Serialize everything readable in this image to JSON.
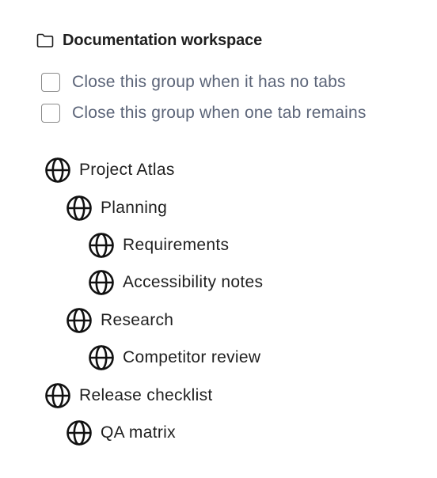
{
  "group": {
    "title": "Documentation workspace",
    "icon": "folder-icon"
  },
  "options": [
    {
      "label": "Close this group when it has no tabs",
      "checked": false
    },
    {
      "label": "Close this group when one tab remains",
      "checked": false
    }
  ],
  "tree": [
    {
      "label": "Project Atlas",
      "level": 0,
      "icon": "globe-icon"
    },
    {
      "label": "Planning",
      "level": 1,
      "icon": "globe-icon"
    },
    {
      "label": "Requirements",
      "level": 2,
      "icon": "globe-icon"
    },
    {
      "label": "Accessibility notes",
      "level": 2,
      "icon": "globe-icon"
    },
    {
      "label": "Research",
      "level": 1,
      "icon": "globe-icon"
    },
    {
      "label": "Competitor review",
      "level": 2,
      "icon": "globe-icon"
    },
    {
      "label": "Release checklist",
      "level": 0,
      "icon": "globe-icon"
    },
    {
      "label": "QA matrix",
      "level": 1,
      "icon": "globe-icon"
    }
  ],
  "colors": {
    "text": "#1f1f1f",
    "option_text": "#5b6478",
    "checkbox_border": "#8a8a8a",
    "background": "#ffffff"
  }
}
